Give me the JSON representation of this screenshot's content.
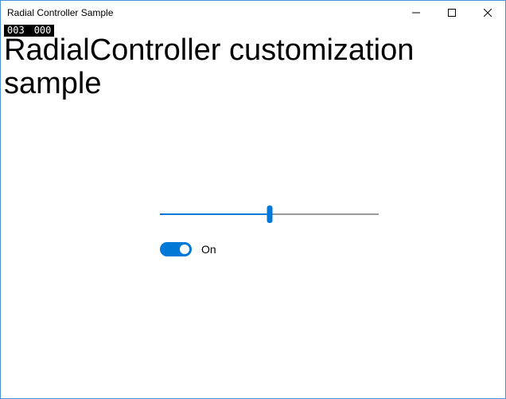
{
  "window": {
    "title": "Radial Controller Sample"
  },
  "debug": {
    "left": "003",
    "right": "000"
  },
  "page": {
    "title": "RadialController customization sample"
  },
  "slider": {
    "value_percent": 50
  },
  "toggle": {
    "on": true,
    "label": "On"
  }
}
